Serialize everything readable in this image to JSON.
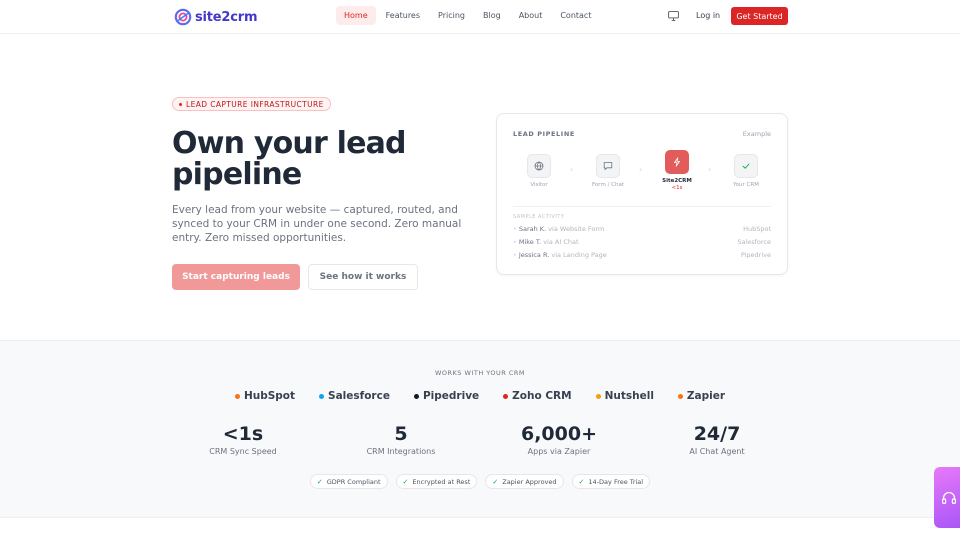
{
  "brand": {
    "name": "site2crm",
    "accent": "#dc2626",
    "logo_color": "#4338ca"
  },
  "nav": {
    "links": [
      {
        "label": "Home",
        "active": true
      },
      {
        "label": "Features",
        "active": false
      },
      {
        "label": "Pricing",
        "active": false
      },
      {
        "label": "Blog",
        "active": false
      },
      {
        "label": "About",
        "active": false
      },
      {
        "label": "Contact",
        "active": false
      }
    ],
    "theme_icon": "monitor-icon",
    "login_label": "Log in",
    "cta_label": "Get Started"
  },
  "hero": {
    "badge": "LEAD CAPTURE INFRASTRUCTURE",
    "title": "Own your lead pipeline",
    "subtitle": "Every lead from your website — captured, routed, and synced to your CRM in under one second. Zero manual entry. Zero missed opportunities.",
    "primary_cta": "Start capturing leads",
    "secondary_cta": "See how it works"
  },
  "pipeline_card": {
    "title": "LEAD PIPELINE",
    "example_label": "Example",
    "steps": [
      {
        "label": "Visitor",
        "icon": "globe-icon"
      },
      {
        "label": "Form / Chat",
        "icon": "chat-icon"
      },
      {
        "label": "Site2CRM",
        "sub": "<1s",
        "icon": "bolt-icon",
        "highlight": true
      },
      {
        "label": "Your CRM",
        "icon": "check-icon"
      }
    ],
    "sample_title": "SAMPLE ACTIVITY",
    "activity": [
      {
        "name": "Sarah K.",
        "via": "via Website Form",
        "crm": "HubSpot"
      },
      {
        "name": "Mike T.",
        "via": "via AI Chat",
        "crm": "Salesforce"
      },
      {
        "name": "Jessica R.",
        "via": "via Landing Page",
        "crm": "Pipedrive"
      }
    ]
  },
  "integrations": {
    "label": "WORKS WITH YOUR CRM",
    "crms": [
      {
        "name": "HubSpot",
        "color": "#f97316"
      },
      {
        "name": "Salesforce",
        "color": "#0ea5e9"
      },
      {
        "name": "Pipedrive",
        "color": "#111827"
      },
      {
        "name": "Zoho CRM",
        "color": "#dc2626"
      },
      {
        "name": "Nutshell",
        "color": "#f59e0b"
      },
      {
        "name": "Zapier",
        "color": "#f97316"
      }
    ]
  },
  "stats": [
    {
      "value": "<1s",
      "label": "CRM Sync Speed"
    },
    {
      "value": "5",
      "label": "CRM Integrations"
    },
    {
      "value": "6,000+",
      "label": "Apps via Zapier"
    },
    {
      "value": "24/7",
      "label": "AI Chat Agent"
    }
  ],
  "trust_pills": [
    "GDPR Compliant",
    "Encrypted at Rest",
    "Zapier Approved",
    "14-Day Free Trial"
  ],
  "support_widget": {
    "icon": "headset-icon"
  }
}
